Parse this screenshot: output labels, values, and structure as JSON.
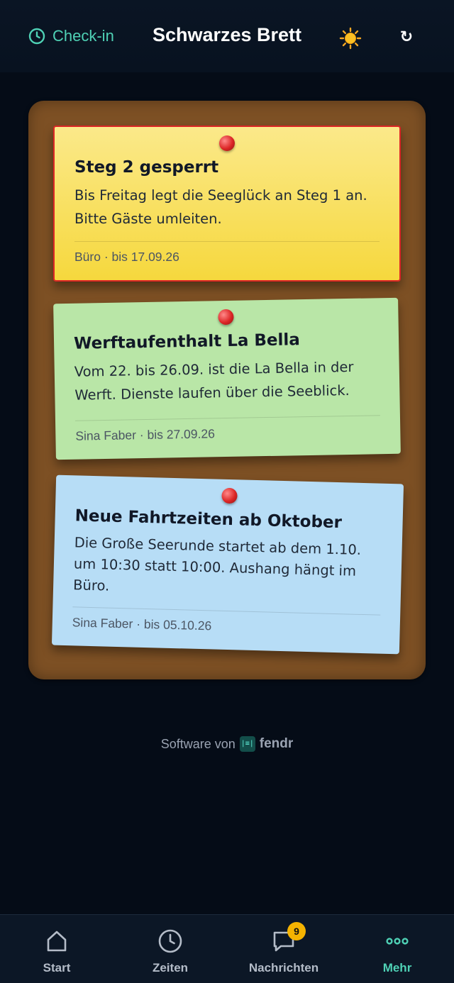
{
  "header": {
    "checkin_label": "Check-in",
    "title": "Schwarzes Brett",
    "theme_icon": "sun-icon",
    "refresh_glyph": "↻"
  },
  "notes": [
    {
      "title": "Steg 2 gesperrt",
      "body": "Bis Freitag legt die Seeglück an Steg 1 an. Bitte Gäste umleiten.",
      "meta": "Büro · bis 17.09.26",
      "color": "#f6d83d",
      "highlighted": true
    },
    {
      "title": "Werftaufenthalt La Bella",
      "body": "Vom 22. bis 26.09. ist die La Bella in der Werft. Dienste laufen über die Seeblick.",
      "meta": "Sina Faber · bis 27.09.26",
      "color": "#b9e6a7"
    },
    {
      "title": "Neue Fahrtzeiten ab Oktober",
      "body": "Die Große Seerunde startet ab dem 1.10. um 10:30 statt 10:00. Aushang hängt im Büro.",
      "meta": "Sina Faber · bis 05.10.26",
      "color": "#b7ddf6"
    }
  ],
  "footer": {
    "software_by": "Software von",
    "brand_logo_text": "|≡|",
    "brand": "fendr"
  },
  "tabs": [
    {
      "label": "Start",
      "icon": "home-icon"
    },
    {
      "label": "Zeiten",
      "icon": "clock-icon"
    },
    {
      "label": "Nachrichten",
      "icon": "chat-icon",
      "badge": "9"
    },
    {
      "label": "Mehr",
      "icon": "more-icon",
      "active": true
    }
  ],
  "colors": {
    "background": "#050c17",
    "accent": "#4fd1b5",
    "board": "#7d5024",
    "badge": "#f5b301",
    "pin": "#dc2626"
  }
}
